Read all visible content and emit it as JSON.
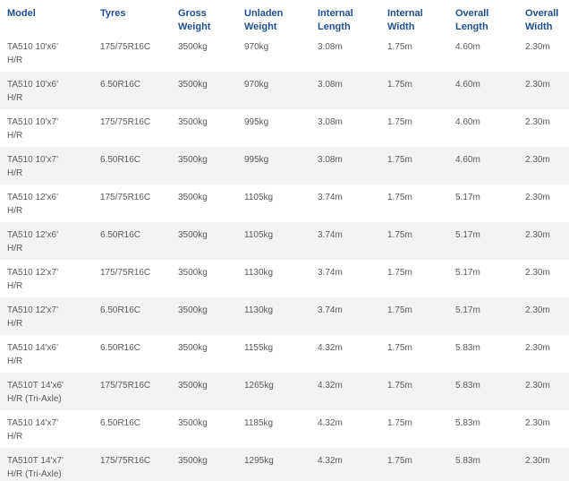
{
  "headers": [
    {
      "line1": "Model",
      "line2": ""
    },
    {
      "line1": "Tyres",
      "line2": ""
    },
    {
      "line1": "Gross",
      "line2": "Weight"
    },
    {
      "line1": "Unladen",
      "line2": "Weight"
    },
    {
      "line1": "Internal",
      "line2": "Length"
    },
    {
      "line1": "Internal",
      "line2": "Width"
    },
    {
      "line1": "Overall",
      "line2": "Length"
    },
    {
      "line1": "Overall",
      "line2": "Width"
    }
  ],
  "rows": [
    {
      "model_line1": "TA510 10'x6'",
      "model_line2": "H/R",
      "tyres": "175/75R16C",
      "gross_weight": "3500kg",
      "unladen_weight": "970kg",
      "internal_length": "3.08m",
      "internal_width": "1.75m",
      "overall_length": "4.60m",
      "overall_width": "2.30m"
    },
    {
      "model_line1": "TA510 10'x6'",
      "model_line2": "H/R",
      "tyres": "6.50R16C",
      "gross_weight": "3500kg",
      "unladen_weight": "970kg",
      "internal_length": "3.08m",
      "internal_width": "1.75m",
      "overall_length": "4.60m",
      "overall_width": "2.30m"
    },
    {
      "model_line1": "TA510 10'x7'",
      "model_line2": "H/R",
      "tyres": "175/75R16C",
      "gross_weight": "3500kg",
      "unladen_weight": "995kg",
      "internal_length": "3.08m",
      "internal_width": "1.75m",
      "overall_length": "4.60m",
      "overall_width": "2.30m"
    },
    {
      "model_line1": "TA510 10'x7'",
      "model_line2": "H/R",
      "tyres": "6.50R16C",
      "gross_weight": "3500kg",
      "unladen_weight": "995kg",
      "internal_length": "3.08m",
      "internal_width": "1.75m",
      "overall_length": "4.60m",
      "overall_width": "2.30m"
    },
    {
      "model_line1": "TA510 12'x6'",
      "model_line2": "H/R",
      "tyres": "175/75R16C",
      "gross_weight": "3500kg",
      "unladen_weight": "1105kg",
      "internal_length": "3.74m",
      "internal_width": "1.75m",
      "overall_length": "5.17m",
      "overall_width": "2.30m"
    },
    {
      "model_line1": "TA510 12'x6'",
      "model_line2": "H/R",
      "tyres": "6.50R16C",
      "gross_weight": "3500kg",
      "unladen_weight": "1105kg",
      "internal_length": "3.74m",
      "internal_width": "1.75m",
      "overall_length": "5.17m",
      "overall_width": "2.30m"
    },
    {
      "model_line1": "TA510 12'x7'",
      "model_line2": "H/R",
      "tyres": "175/75R16C",
      "gross_weight": "3500kg",
      "unladen_weight": "1130kg",
      "internal_length": "3.74m",
      "internal_width": "1.75m",
      "overall_length": "5.17m",
      "overall_width": "2.30m"
    },
    {
      "model_line1": "TA510 12'x7'",
      "model_line2": "H/R",
      "tyres": "6.50R16C",
      "gross_weight": "3500kg",
      "unladen_weight": "1130kg",
      "internal_length": "3.74m",
      "internal_width": "1.75m",
      "overall_length": "5.17m",
      "overall_width": "2.30m"
    },
    {
      "model_line1": "TA510 14'x6'",
      "model_line2": "H/R",
      "tyres": "6.50R16C",
      "gross_weight": "3500kg",
      "unladen_weight": "1155kg",
      "internal_length": "4.32m",
      "internal_width": "1.75m",
      "overall_length": "5.83m",
      "overall_width": "2.30m"
    },
    {
      "model_line1": "TA510T 14'x6'",
      "model_line2": "H/R (Tri-Axle)",
      "tyres": "175/75R16C",
      "gross_weight": "3500kg",
      "unladen_weight": "1265kg",
      "internal_length": "4.32m",
      "internal_width": "1.75m",
      "overall_length": "5.83m",
      "overall_width": "2.30m"
    },
    {
      "model_line1": "TA510 14'x7'",
      "model_line2": "H/R",
      "tyres": "6.50R16C",
      "gross_weight": "3500kg",
      "unladen_weight": "1185kg",
      "internal_length": "4.32m",
      "internal_width": "1.75m",
      "overall_length": "5.83m",
      "overall_width": "2.30m"
    },
    {
      "model_line1": "TA510T 14'x7'",
      "model_line2": "H/R (Tri-Axle)",
      "tyres": "175/75R16C",
      "gross_weight": "3500kg",
      "unladen_weight": "1295kg",
      "internal_length": "4.32m",
      "internal_width": "1.75m",
      "overall_length": "5.83m",
      "overall_width": "2.30m"
    }
  ]
}
